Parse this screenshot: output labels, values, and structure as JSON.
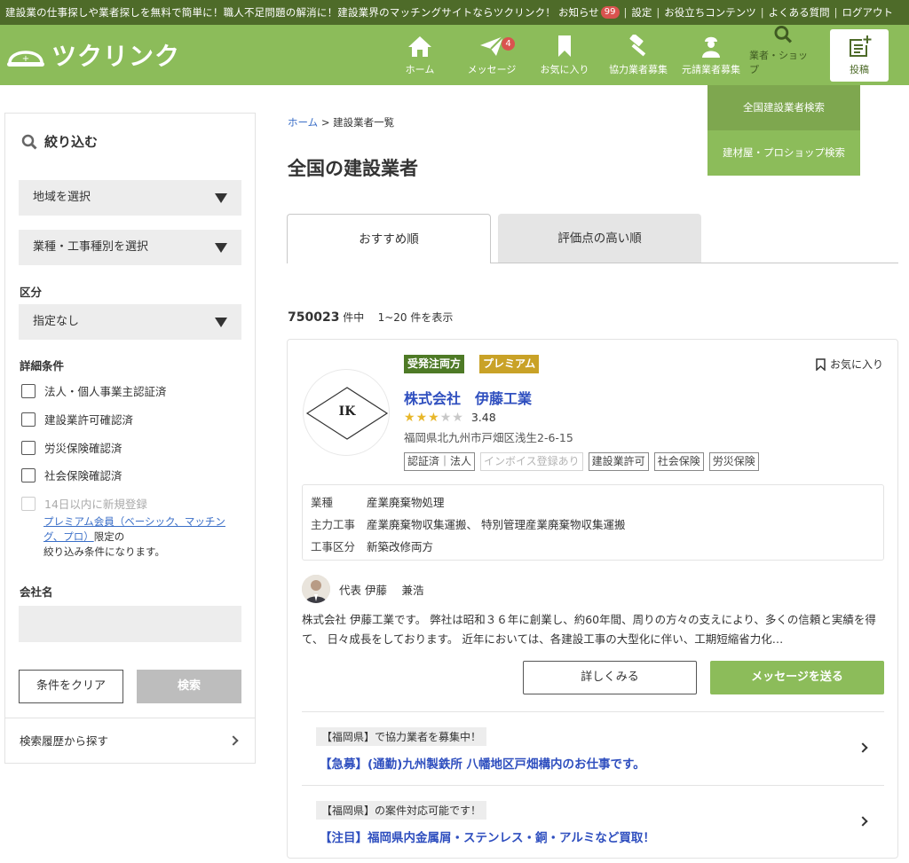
{
  "topbar": {
    "message": "建設業の仕事探しや業者探しを無料で簡単に！職人不足問題の解消に！建設業界のマッチングサイトならツクリンク！",
    "notice": "お知らせ",
    "notice_count": "99",
    "settings": "設定",
    "useful": "お役立ちコンテンツ",
    "faq": "よくある質問",
    "logout": "ログアウト"
  },
  "header": {
    "logo": "ツクリンク",
    "nav": {
      "home": "ホーム",
      "message": "メッセージ",
      "message_count": "4",
      "favorite": "お気に入り",
      "partner": "協力業者募集",
      "contractor": "元請業者募集",
      "shop": "業者・ショップ",
      "post": "投稿"
    }
  },
  "dropdown": {
    "item1": "全国建設業者検索",
    "item2": "建材屋・プロショップ検索"
  },
  "sidebar": {
    "title": "絞り込む",
    "region": "地域を選択",
    "industry": "業種・工事種別を選択",
    "category_label": "区分",
    "category_value": "指定なし",
    "detail_label": "詳細条件",
    "checks": [
      "法人・個人事業主認証済",
      "建設業許可確認済",
      "労災保険確認済",
      "社会保険確認済"
    ],
    "new_check": "14日以内に新規登録",
    "premium_link": "プレミアム会員（ベーシック、マッチング、プロ）",
    "premium_suffix": "限定の",
    "premium_line2": "絞り込み条件になります。",
    "company_label": "会社名",
    "clear": "条件をクリア",
    "search": "検索",
    "history": "検索履歴から探す"
  },
  "main": {
    "crumb_home": "ホーム",
    "crumb_current": "> 建設業者一覧",
    "title": "全国の建設業者",
    "tab_recommend": "おすすめ順",
    "tab_rating": "評価点の高い順",
    "count": "750023",
    "count_unit": "件中",
    "range": "1~20 件を表示"
  },
  "card": {
    "logo_text": "IK",
    "tag1": "受発注両方",
    "tag2": "プレミアム",
    "fav": "お気に入り",
    "name": "株式会社　伊藤工業",
    "rating": "3.48",
    "rating_value": 3,
    "address": "福岡県北九州市戸畑区浅生2-6-15",
    "badges": [
      "認証済｜法人",
      "インボイス登録あり",
      "建設業許可",
      "社会保険",
      "労災保険"
    ],
    "info": [
      {
        "k": "業種",
        "v": "産業廃棄物処理"
      },
      {
        "k": "主力工事",
        "v": "産業廃棄物収集運搬、 特別管理産業廃棄物収集運搬"
      },
      {
        "k": "工事区分",
        "v": "新築改修両方"
      }
    ],
    "rep": "代表  伊藤　 兼浩",
    "desc": "株式会社 伊藤工業です。 弊社は昭和３６年に創業し、約60年間、周りの方々の支えにより、多くの信頼と実績を得て、 日々成長をしております。 近年においては、各建設工事の大型化に伴い、工期短縮省力化…",
    "detail_btn": "詳しくみる",
    "msg_btn": "メッセージを送る",
    "jobs": [
      {
        "tag": "【福岡県】で協力業者を募集中！",
        "title": "【急募】(通勤)九州製鉄所 八幡地区戸畑構内のお仕事です。"
      },
      {
        "tag": "【福岡県】の案件対応可能です！",
        "title": "【注目】福岡県内金属屑・ステンレス・銅・アルミなど買取！"
      }
    ]
  }
}
